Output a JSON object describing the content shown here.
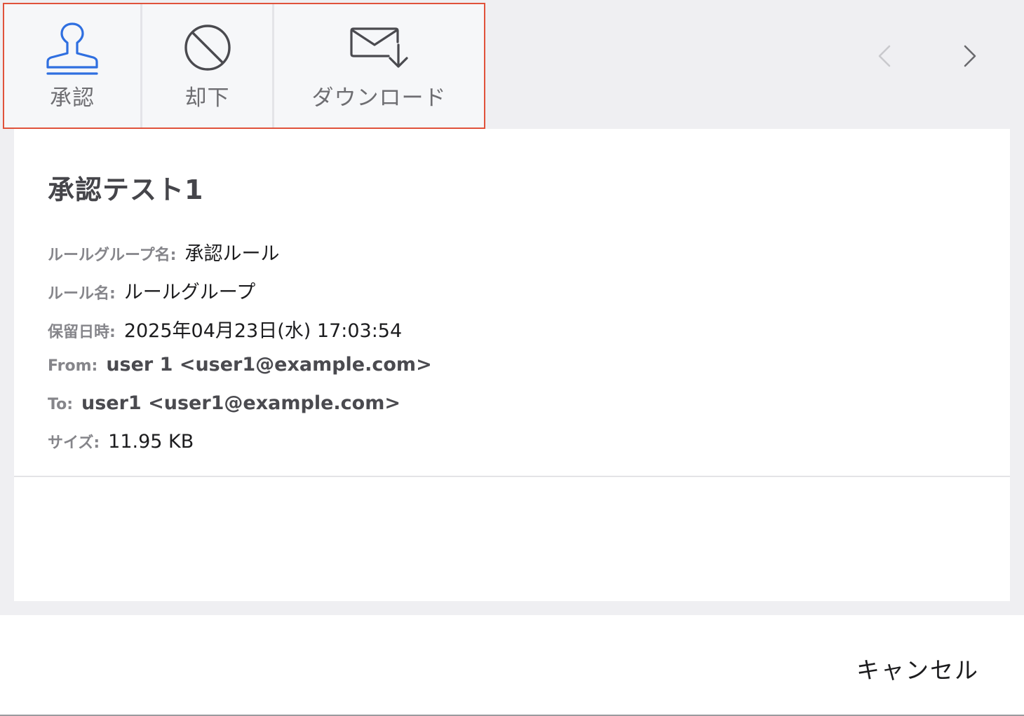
{
  "toolbar": {
    "buttons": [
      {
        "label": "承認",
        "icon": "stamp-icon",
        "color": "#2f6fe0"
      },
      {
        "label": "却下",
        "icon": "prohibit-icon",
        "color": "#4a4a4f"
      },
      {
        "label": "ダウンロード",
        "icon": "mail-download-icon",
        "color": "#4a4a4f"
      }
    ],
    "highlight_color": "#e0523b",
    "prev_icon": "chevron-left-icon",
    "next_icon": "chevron-right-icon"
  },
  "detail": {
    "title": "承認テスト1",
    "fields": [
      {
        "label": "ルールグループ名:",
        "value": "承認ルール"
      },
      {
        "label": "ルール名:",
        "value": "ルールグループ"
      },
      {
        "label": "保留日時:",
        "value": "2025年04月23日(水) 17:03:54"
      },
      {
        "label": "From:",
        "value": "user 1 <user1@example.com>"
      },
      {
        "label": "To:",
        "value": "user1 <user1@example.com>"
      },
      {
        "label": "サイズ:",
        "value": "11.95 KB"
      }
    ]
  },
  "footer": {
    "cancel_label": "キャンセル"
  }
}
